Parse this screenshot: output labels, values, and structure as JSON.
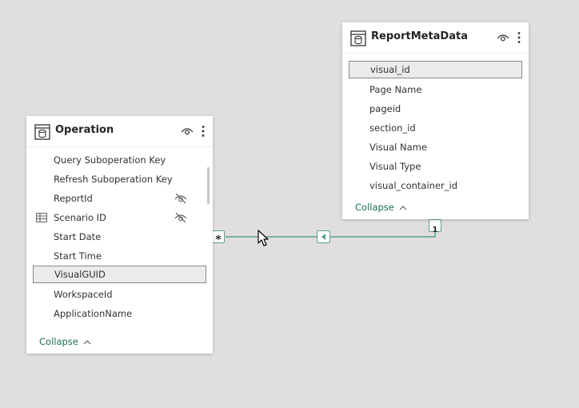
{
  "tables": {
    "operation": {
      "title": "Operation",
      "fields": [
        {
          "label": "Query Suboperation Key",
          "hidden": false,
          "calculated": false,
          "selected": false
        },
        {
          "label": "Refresh Suboperation Key",
          "hidden": false,
          "calculated": false,
          "selected": false
        },
        {
          "label": "ReportId",
          "hidden": true,
          "calculated": false,
          "selected": false
        },
        {
          "label": "Scenario ID",
          "hidden": true,
          "calculated": true,
          "selected": false
        },
        {
          "label": "Start Date",
          "hidden": false,
          "calculated": false,
          "selected": false
        },
        {
          "label": "Start Time",
          "hidden": false,
          "calculated": false,
          "selected": false
        },
        {
          "label": "VisualGUID",
          "hidden": false,
          "calculated": false,
          "selected": true
        },
        {
          "label": "WorkspaceId",
          "hidden": false,
          "calculated": false,
          "selected": false
        },
        {
          "label": "ApplicationName",
          "hidden": false,
          "calculated": false,
          "selected": false
        }
      ],
      "collapse_label": "Collapse"
    },
    "report_meta": {
      "title": "ReportMetaData",
      "fields": [
        {
          "label": "visual_id",
          "selected": true
        },
        {
          "label": "Page Name",
          "selected": false
        },
        {
          "label": "pageid",
          "selected": false
        },
        {
          "label": "section_id",
          "selected": false
        },
        {
          "label": "Visual Name",
          "selected": false
        },
        {
          "label": "Visual Type",
          "selected": false
        },
        {
          "label": "visual_container_id",
          "selected": false
        }
      ],
      "collapse_label": "Collapse"
    }
  },
  "relationship": {
    "many_marker": "*",
    "one_marker": "1",
    "color": "#5e9e8a"
  },
  "colors": {
    "canvas": "#e1dfdd",
    "accent": "#1a6e5a"
  }
}
